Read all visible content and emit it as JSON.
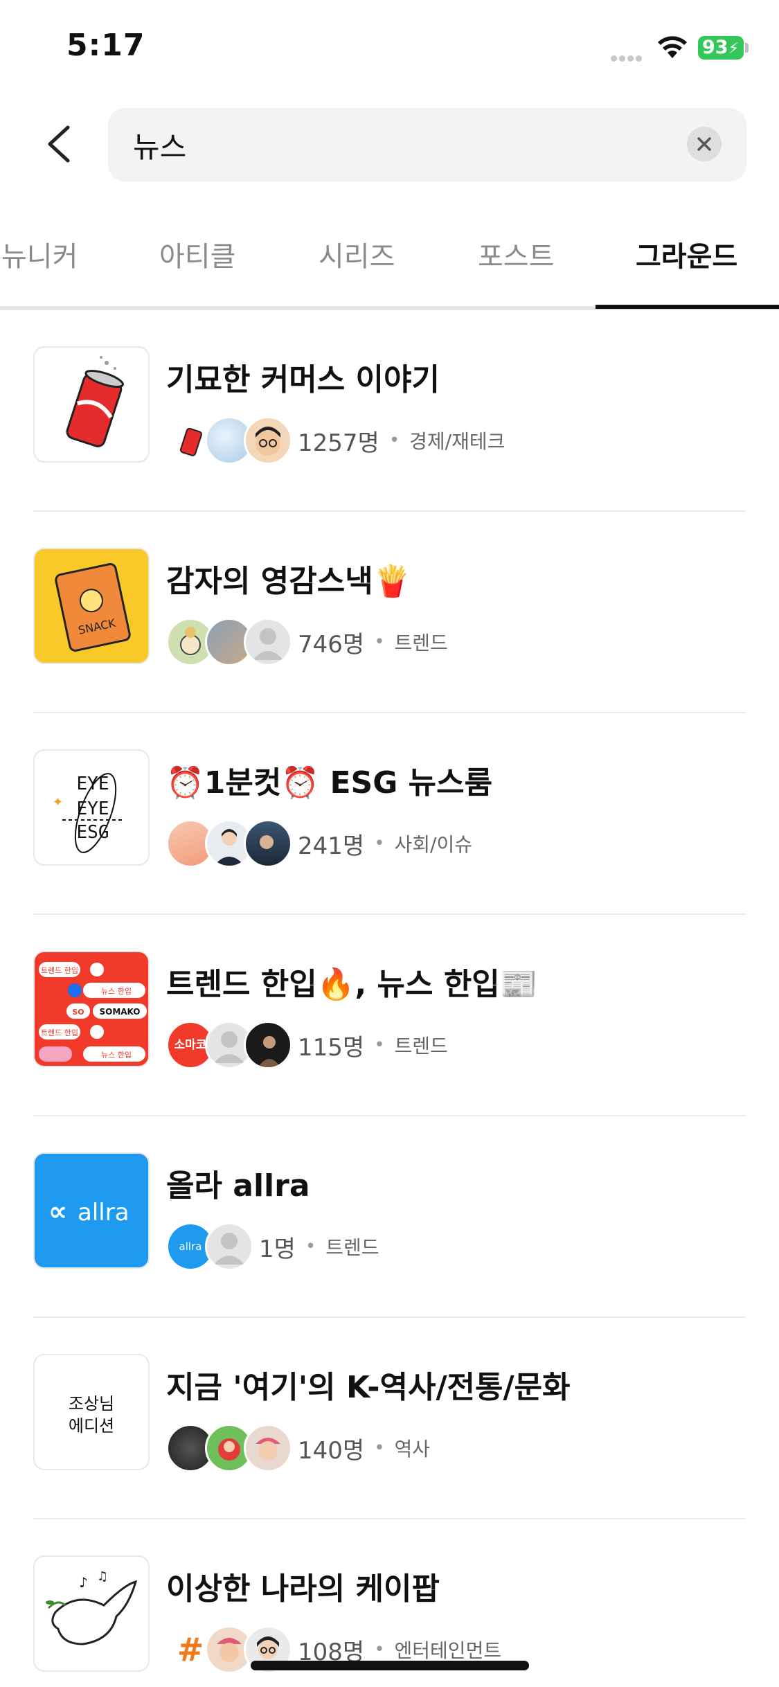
{
  "status": {
    "time": "5:17",
    "battery": "93"
  },
  "search": {
    "query": "뉴스"
  },
  "tabs": [
    {
      "label": "뉴니커"
    },
    {
      "label": "아티클"
    },
    {
      "label": "시리즈"
    },
    {
      "label": "포스트"
    },
    {
      "label": "그라운드"
    }
  ],
  "grounds": [
    {
      "title": "기묘한 커머스 이야기",
      "count": "1257명",
      "category": "경제/재테크"
    },
    {
      "title": "감자의 영감스낵🍟",
      "count": "746명",
      "category": "트렌드"
    },
    {
      "title": "⏰1분컷⏰ ESG 뉴스룸",
      "count": "241명",
      "category": "사회/이슈"
    },
    {
      "title": "트렌드 한입🔥, 뉴스 한입📰",
      "count": "115명",
      "category": "트렌드"
    },
    {
      "title": "올라 allra",
      "count": "1명",
      "category": "트렌드"
    },
    {
      "title": "지금 '여기'의 K-역사/전통/문화",
      "count": "140명",
      "category": "역사"
    },
    {
      "title": "이상한 나라의 케이팝",
      "count": "108명",
      "category": "엔터테인먼트"
    }
  ],
  "thumb_text": {
    "snack": "SNACK",
    "eye1": "EYE",
    "eye2": "EYE",
    "esg": "ESG",
    "somako1": "트렌드 한입",
    "somako2": "뉴스 한입",
    "somako3": "SO",
    "somako4": "SOMAKO",
    "somako5": "트렌드 한입",
    "somako6": "뉴스 한입",
    "allra": "allra",
    "allra_small": "allra",
    "edition1": "조상님",
    "edition2": "에디션",
    "avatar_logo": "소마코"
  },
  "colors": {
    "accent": "#111111",
    "battery": "#34c759",
    "allra_blue": "#1e9bf0",
    "somako_red": "#f23a2a"
  }
}
